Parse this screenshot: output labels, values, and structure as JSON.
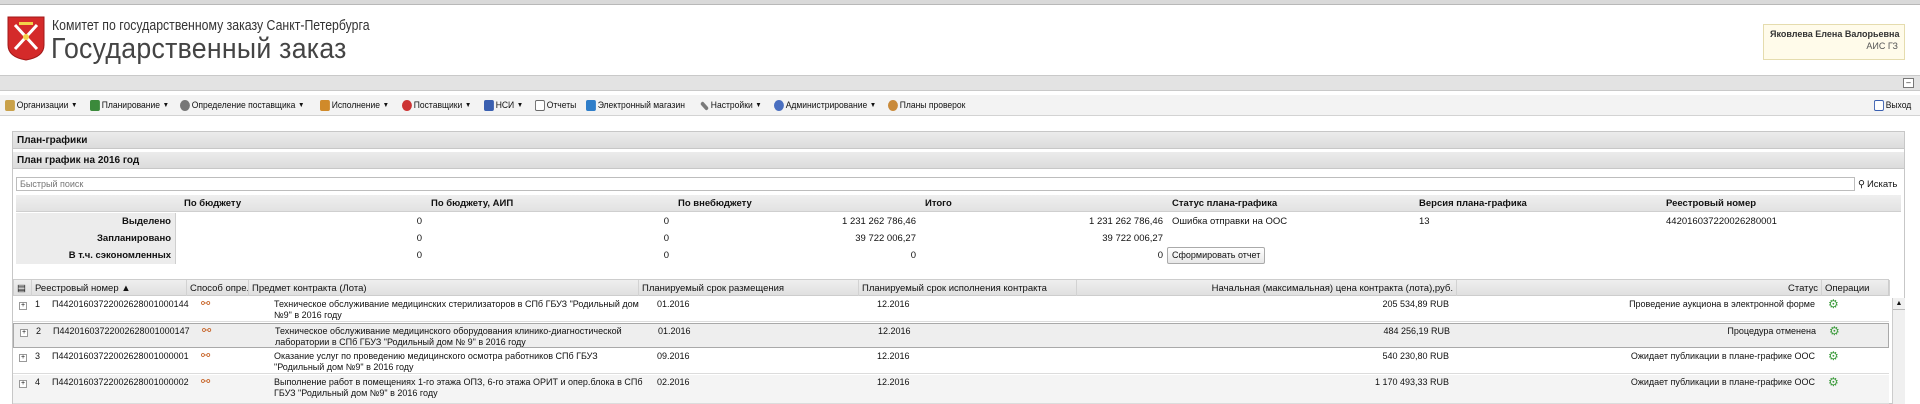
{
  "header": {
    "org_title": "Комитет по государственному заказу Санкт-Петербурга",
    "app_title": "Государственный заказ",
    "user_name": "Яковлева Елена Валорьевна",
    "system": "АИС ГЗ"
  },
  "collapse_glyph": "–",
  "menu": {
    "items": [
      {
        "label": "Организации",
        "icon": "folder-icon",
        "color": "#c9a14a"
      },
      {
        "label": "Планирование",
        "icon": "chart-icon",
        "color": "#3b8a3b"
      },
      {
        "label": "Определение поставщика",
        "icon": "gear-icon",
        "color": "#777777"
      },
      {
        "label": "Исполнение",
        "icon": "tasks-icon",
        "color": "#d08a2a"
      },
      {
        "label": "Поставщики",
        "icon": "target-icon",
        "color": "#cc3333"
      },
      {
        "label": "НСИ",
        "icon": "book-icon",
        "color": "#3a5fb0"
      },
      {
        "label": "Отчеты",
        "icon": "report-icon",
        "color": "#6a6a6a"
      },
      {
        "label": "Электронный магазин",
        "icon": "shop-icon",
        "color": "#2f7ec9"
      },
      {
        "label": "Настройки",
        "icon": "wrench-icon",
        "color": "#7a7a7a"
      },
      {
        "label": "Администрирование",
        "icon": "admin-icon",
        "color": "#4a6fc0"
      },
      {
        "label": "Планы проверок",
        "icon": "user-icon",
        "color": "#c98a3a"
      }
    ],
    "exit_label": "Выход"
  },
  "panel": {
    "title": "План-графики",
    "subtitle": "План график на 2016 год",
    "search_placeholder": "Быстрый поиск",
    "search_button": "Искать"
  },
  "summary": {
    "columns": [
      "По бюджету",
      "По бюджету, АИП",
      "По внебюджету",
      "Итого",
      "Статус плана-графика",
      "Версия плана-графика",
      "Реестровый номер"
    ],
    "rows": [
      {
        "label": "Выделено",
        "values": [
          "0",
          "0",
          "1 231 262 786,46",
          "1 231 262 786,46"
        ],
        "status": "Ошибка отправки на ООС",
        "version": "13",
        "registry": "442016037220026280001"
      },
      {
        "label": "Запланировано",
        "values": [
          "0",
          "0",
          "39 722 006,27",
          "39 722 006,27"
        ]
      },
      {
        "label": "В т.ч. сэкономленных",
        "values": [
          "0",
          "0",
          "0",
          "0"
        ]
      }
    ],
    "report_button": "Сформировать отчет"
  },
  "grid": {
    "columns": [
      "Реестровый номер",
      "Способ опре...",
      "Предмет контракта (Лота)",
      "Планируемый срок размещения",
      "Планируемый срок исполнения контракта",
      "Начальная (максимальная) цена контракта (лота),руб.",
      "Статус",
      "Операции"
    ],
    "rows": [
      {
        "n": "1",
        "reg": "П44201603722002628001000144",
        "subject": "Техническое обслуживание медицинских стерилизаторов в СПб ГБУЗ \"Родильный дом №9\" в 2016 году",
        "place": "01.2016",
        "exec": "12.2016",
        "price": "205 534,89 RUB",
        "status": "Проведение аукциона в электронной форме"
      },
      {
        "n": "2",
        "reg": "П44201603722002628001000147",
        "subject": "Техническое обслуживание медицинского оборудования клинико-диагностической лаборатории в СПб ГБУЗ \"Родильный дом № 9\" в 2016 году",
        "place": "01.2016",
        "exec": "12.2016",
        "price": "484 256,19 RUB",
        "status": "Процедура отменена"
      },
      {
        "n": "3",
        "reg": "П44201603722002628001000001",
        "subject": "Оказание услуг по проведению медицинского осмотра работников СПб ГБУЗ \"Родильный дом №9\" в 2016 году",
        "place": "09.2016",
        "exec": "12.2016",
        "price": "540 230,80 RUB",
        "status": "Ожидает публикации в плане-графике ООС"
      },
      {
        "n": "4",
        "reg": "П44201603722002628001000002",
        "subject": "Выполнение работ в помещениях 1-го этажа ОПЗ, 6-го этажа ОРИТ и опер.блока в СПб ГБУЗ \"Родильный дом №9\" в 2016 году",
        "place": "02.2016",
        "exec": "12.2016",
        "price": "1 170 493,33 RUB",
        "status": "Ожидает публикации в плане-графике ООС"
      }
    ]
  }
}
